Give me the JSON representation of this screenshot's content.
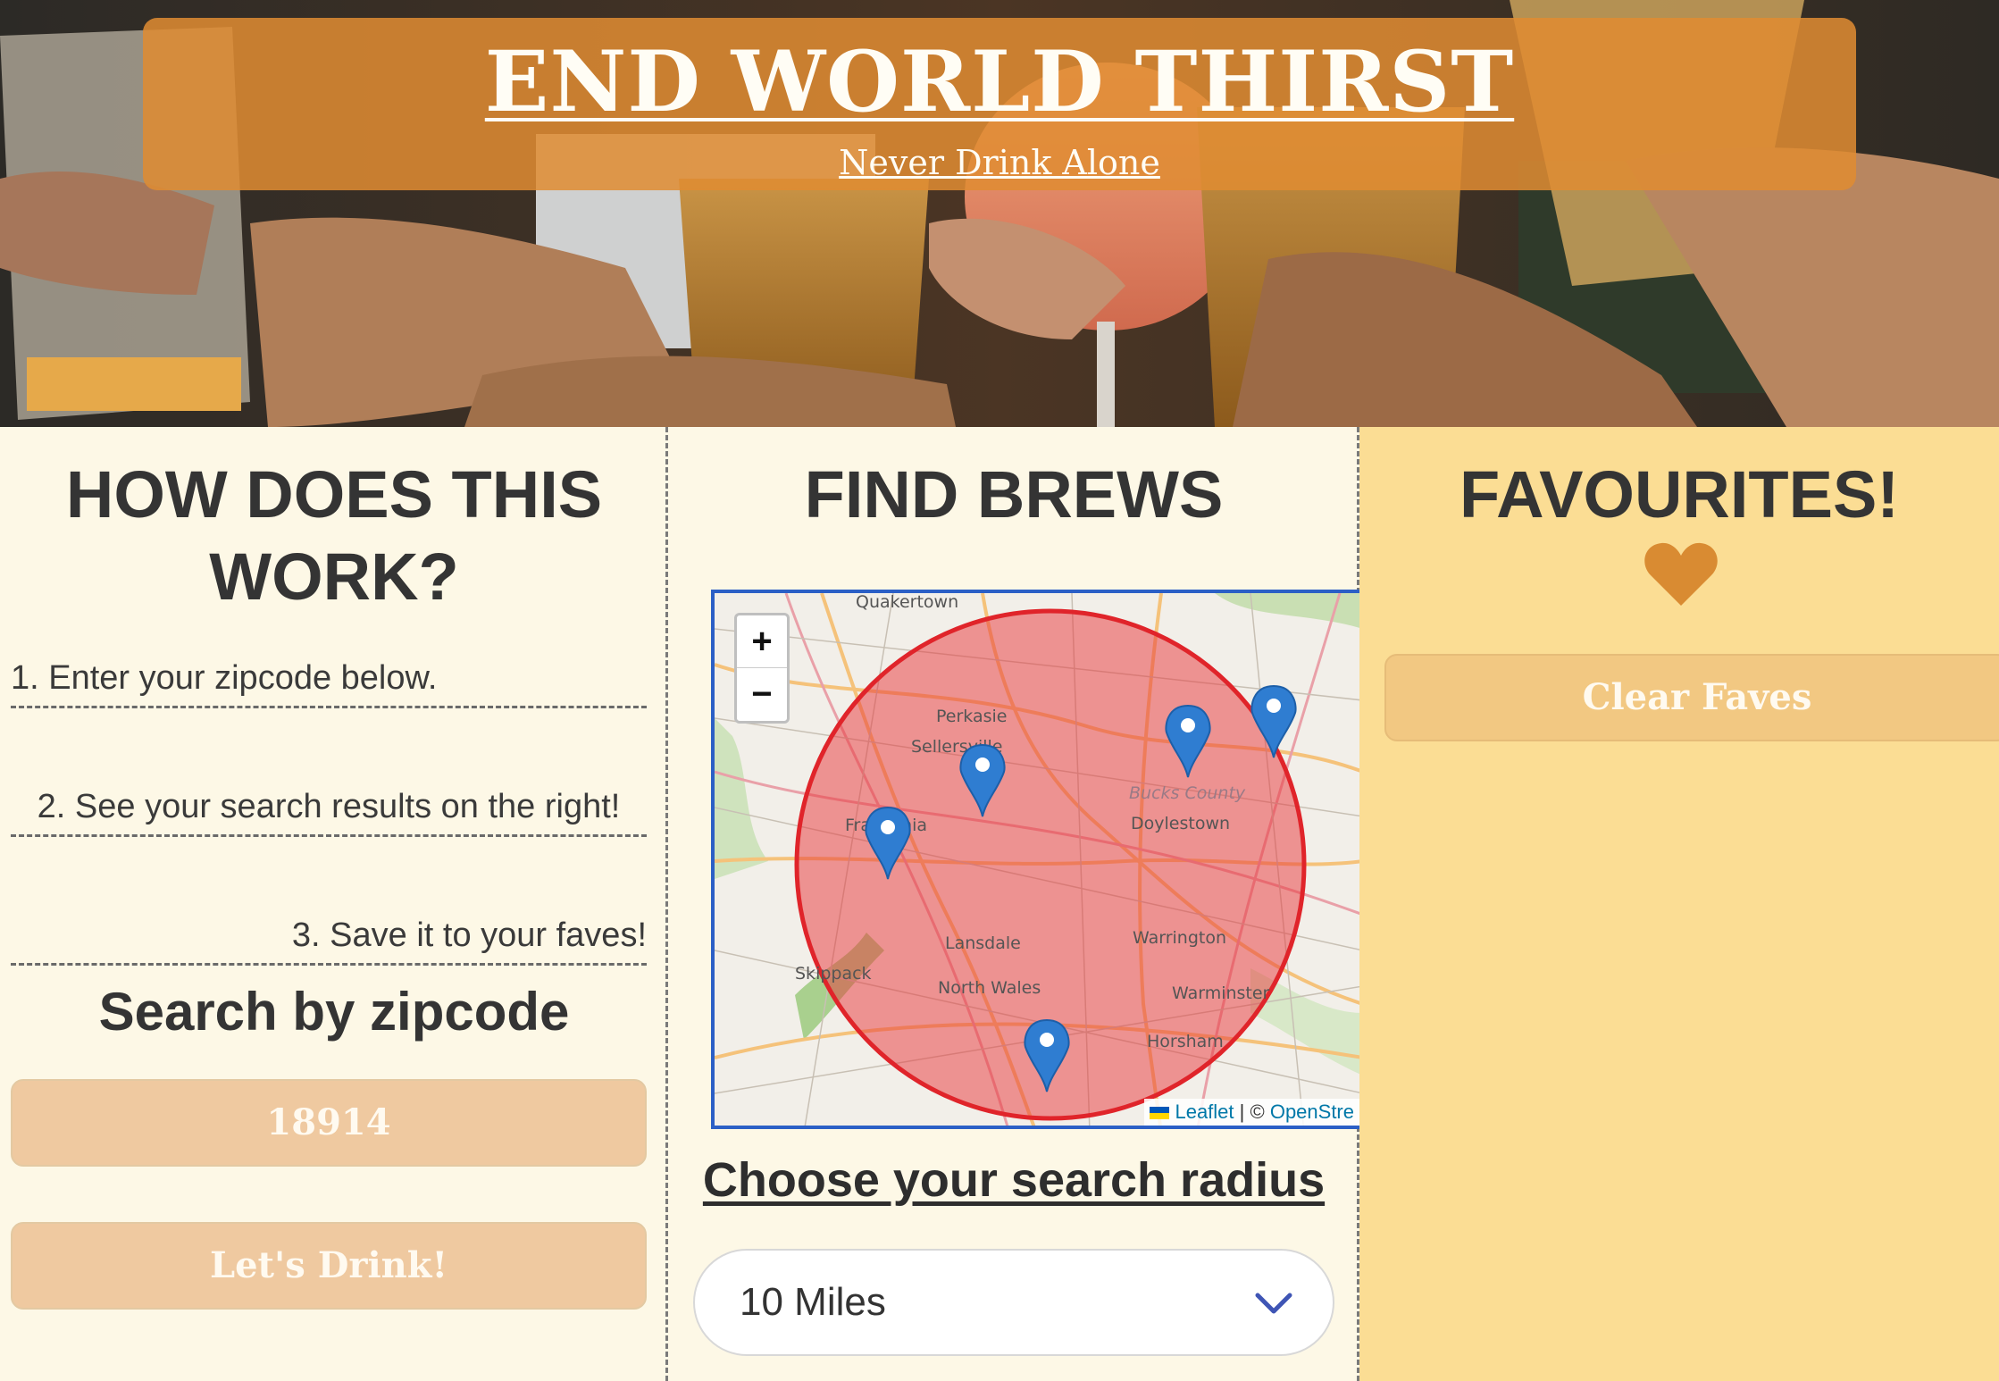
{
  "hero": {
    "title": "END WORLD THIRST",
    "tagline": "Never Drink Alone"
  },
  "left": {
    "heading": "HOW DOES THIS WORK?",
    "steps": [
      "1. Enter your zipcode below.",
      "2. See your search results on the right!",
      "3. Save it to your faves!"
    ],
    "search_heading": "Search by zipcode",
    "zipcode_value": "18914",
    "submit_label": "Let's Drink!"
  },
  "middle": {
    "heading": "FIND BREWS",
    "map": {
      "zoom_in": "+",
      "zoom_out": "−",
      "places": [
        "Quakertown",
        "Perkasie",
        "Sellersville",
        "Franconia",
        "Bucks County",
        "Doylestown",
        "Lansdale",
        "Warrington",
        "Skippack",
        "North Wales",
        "Warminster",
        "Horsham"
      ],
      "attribution_leaflet": "Leaflet",
      "attribution_sep": "| ©",
      "attribution_osm": "OpenStre",
      "circle_color": "#e8353a"
    },
    "radius_label": "Choose your search radius",
    "radius_selected": "10 Miles"
  },
  "right": {
    "heading": "FAVOURITES!",
    "clear_label": "Clear Faves",
    "heart_color": "#d98b32"
  },
  "colors": {
    "banner": "#e08c32",
    "left_bg": "#fdf8e6",
    "right_bg": "#fbdd94",
    "button": "#efc9a0"
  }
}
